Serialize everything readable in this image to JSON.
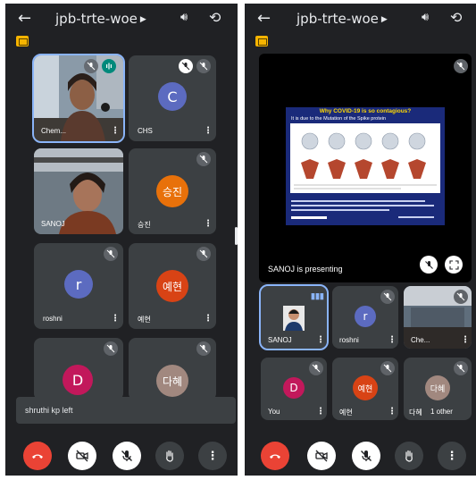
{
  "meeting_code": "jpb-trte-woe",
  "left_screen": {
    "participants": [
      {
        "name": "Chem...",
        "type": "video"
      },
      {
        "name": "CHS",
        "initial": "C",
        "color": "#5c6bc0",
        "type": "avatar"
      },
      {
        "name": "SANOJ",
        "type": "video"
      },
      {
        "name": "승진",
        "initial": "승진",
        "color": "#e8710a",
        "type": "avatar"
      },
      {
        "name": "roshni",
        "initial": "r",
        "color": "#5c6bc0",
        "type": "avatar"
      },
      {
        "name": "예현",
        "initial": "예현",
        "color": "#d84315",
        "type": "avatar"
      },
      {
        "name": "",
        "initial": "D",
        "color": "#c2185b",
        "type": "avatar"
      },
      {
        "name": "",
        "initial": "다혜",
        "color": "#a1887f",
        "type": "avatar"
      }
    ],
    "toast": "shruthi kp left"
  },
  "right_screen": {
    "slide": {
      "title": "Why COVID-19 is so contagious?",
      "subtitle": "It is due to the Mutation of the Spike protein"
    },
    "presenting_label": "SANOJ is presenting",
    "participants": [
      {
        "name": "SANOJ",
        "type": "video"
      },
      {
        "name": "roshni",
        "initial": "r",
        "color": "#5c6bc0",
        "type": "avatar"
      },
      {
        "name": "Che...",
        "type": "video"
      },
      {
        "name": "You",
        "initial": "D",
        "color": "#c2185b",
        "type": "avatar"
      },
      {
        "name": "예현",
        "initial": "예현",
        "color": "#d84315",
        "type": "avatar"
      },
      {
        "name": "다혜",
        "initial": "다혜",
        "color": "#a1887f",
        "type": "avatar"
      },
      {
        "name": "1 other",
        "type": "label"
      }
    ]
  },
  "colors": {
    "background": "#202124",
    "tile": "#3c4043",
    "end_call": "#ea4335",
    "active_speaker": "#8ab4f8",
    "note_badge": "#f6b400"
  },
  "icons": [
    "back-arrow-icon",
    "speaker-icon",
    "switch-camera-icon",
    "mic-off-icon",
    "camera-off-icon",
    "end-call-icon",
    "raise-hand-icon",
    "more-options-icon",
    "fullscreen-icon",
    "audio-wave-icon"
  ]
}
